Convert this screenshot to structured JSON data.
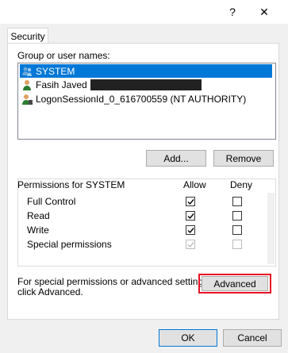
{
  "window": {
    "help_glyph": "?",
    "close_glyph": "✕"
  },
  "tabs": [
    {
      "label": "Security"
    }
  ],
  "group_label": "Group or user names:",
  "users": [
    {
      "name": "SYSTEM",
      "selected": true,
      "icon": "users-group-icon"
    },
    {
      "name": "Fasih Javed",
      "selected": false,
      "icon": "user-icon",
      "redacted": true
    },
    {
      "name": "LogonSessionId_0_616700559 (NT AUTHORITY)",
      "selected": false,
      "icon": "user-shield-icon"
    }
  ],
  "buttons": {
    "add": "Add...",
    "remove": "Remove",
    "advanced": "Advanced",
    "ok": "OK",
    "cancel": "Cancel"
  },
  "permissions": {
    "header": "Permissions for SYSTEM",
    "allow_header": "Allow",
    "deny_header": "Deny",
    "rows": [
      {
        "name": "Full Control",
        "allow": true,
        "deny": false,
        "disabled": false
      },
      {
        "name": "Read",
        "allow": true,
        "deny": false,
        "disabled": false
      },
      {
        "name": "Write",
        "allow": true,
        "deny": false,
        "disabled": false
      },
      {
        "name": "Special permissions",
        "allow": true,
        "deny": false,
        "disabled": true
      }
    ]
  },
  "advanced_note_line1": "For special permissions or advanced settings,",
  "advanced_note_line2": "click Advanced.",
  "colors": {
    "selection": "#0078d7",
    "highlight_border": "#e81123"
  }
}
